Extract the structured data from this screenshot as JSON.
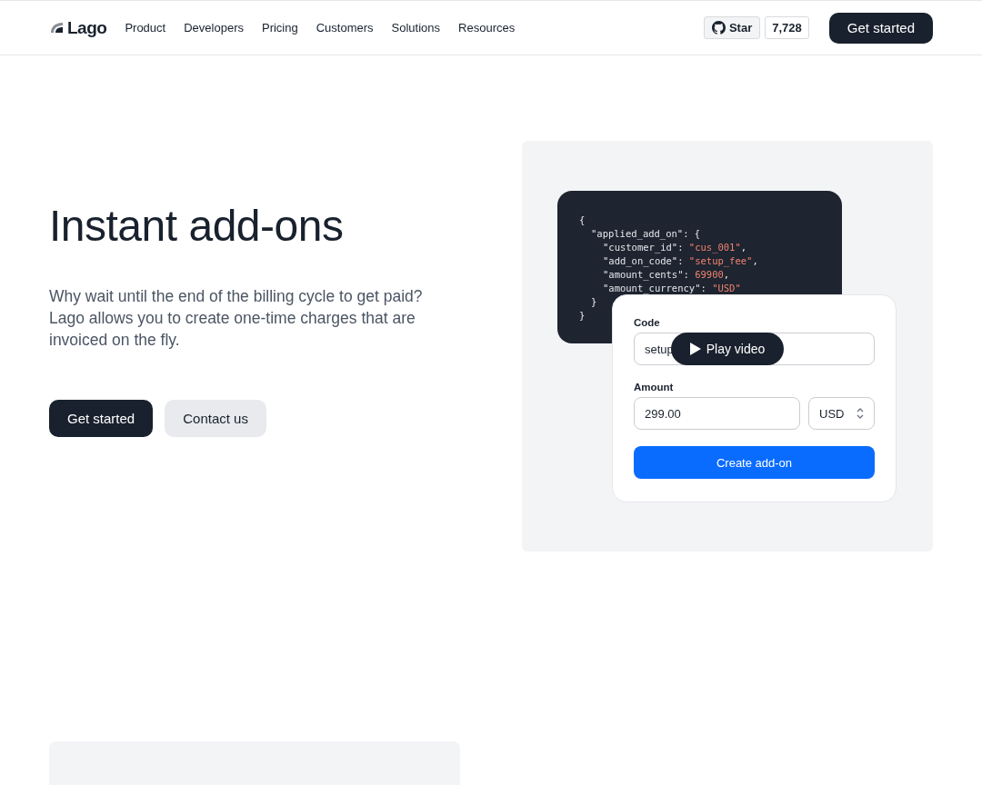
{
  "nav": {
    "logo": "Lago",
    "links": [
      "Product",
      "Developers",
      "Pricing",
      "Customers",
      "Solutions",
      "Resources"
    ],
    "star_label": "Star",
    "star_count": "7,728",
    "cta": "Get started"
  },
  "hero": {
    "title": "Instant add-ons",
    "description": "Why wait until the end of the billing cycle to get paid? Lago allows you to create one-time charges that are invoiced on the fly.",
    "buttons": [
      {
        "label": "Get started",
        "kind": "primary"
      },
      {
        "label": "Contact us",
        "kind": "secondary"
      }
    ]
  },
  "illustration": {
    "code": {
      "open": "{",
      "close": "}",
      "children": [
        {
          "key": "\"applied_add_on\"",
          "sep": ":",
          "open": "{",
          "close": "}",
          "children": [
            {
              "key": "\"customer_id\"",
              "sep": ":",
              "value": "\"cus_001\"",
              "trail": ","
            },
            {
              "key": "\"add_on_code\"",
              "sep": ":",
              "value": "\"setup_fee\"",
              "trail": ","
            },
            {
              "key": "\"amount_cents\"",
              "sep": ":",
              "value": "69900",
              "trail": ","
            },
            {
              "key": "\"amount_currency\"",
              "sep": ":",
              "value": "\"USD\""
            }
          ]
        }
      ]
    },
    "form": {
      "code_label": "Code",
      "code_value": "setup",
      "amount_label": "Amount",
      "amount_value": "299.00",
      "currency": "USD",
      "submit": "Create add-on"
    },
    "play_button": "Play video"
  }
}
